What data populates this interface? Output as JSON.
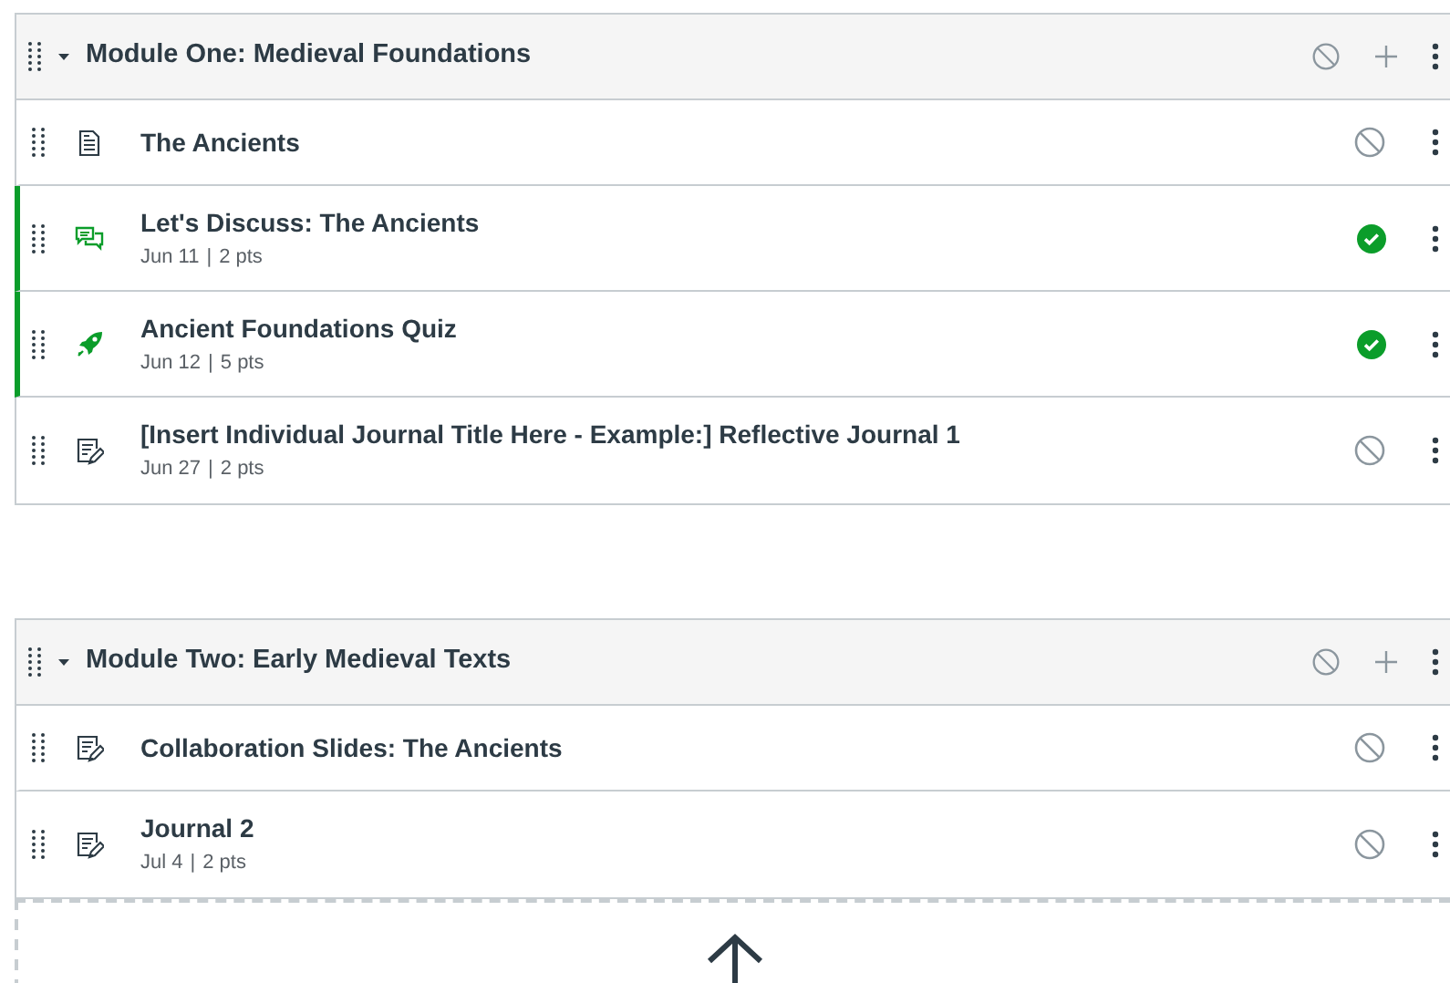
{
  "modules": [
    {
      "title": "Module One: Medieval Foundations",
      "expanded": true,
      "published": false,
      "items": [
        {
          "kind": "page",
          "title": "The Ancients",
          "published": false
        },
        {
          "kind": "discussion",
          "title": "Let's Discuss: The Ancients",
          "date": "Jun 11",
          "separator": "|",
          "points": "2 pts",
          "published": true
        },
        {
          "kind": "quiz",
          "title": "Ancient Foundations Quiz",
          "date": "Jun 12",
          "separator": "|",
          "points": "5 pts",
          "published": true
        },
        {
          "kind": "assignment",
          "title": "[Insert Individual Journal Title Here - Example:] Reflective Journal 1",
          "date": "Jun 27",
          "separator": "|",
          "points": "2 pts",
          "published": false
        }
      ]
    },
    {
      "title": "Module Two: Early Medieval Texts",
      "expanded": true,
      "published": false,
      "items": [
        {
          "kind": "assignment",
          "title": "Collaboration Slides: The Ancients",
          "published": false
        },
        {
          "kind": "assignment",
          "title": "Journal 2",
          "date": "Jul 4",
          "separator": "|",
          "points": "2 pts",
          "published": false
        }
      ]
    }
  ],
  "drop_zone": {
    "kind": "upload"
  }
}
